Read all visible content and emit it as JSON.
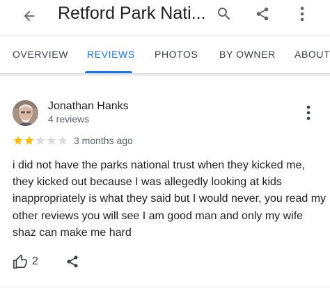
{
  "appbar": {
    "title": "Retford Park Nati...",
    "icons": [
      "back-arrow-icon",
      "search-icon",
      "share-icon",
      "more-vert-icon"
    ]
  },
  "tabs": [
    {
      "label": "OVERVIEW",
      "active": false
    },
    {
      "label": "REVIEWS",
      "active": true
    },
    {
      "label": "PHOTOS",
      "active": false
    },
    {
      "label": "BY OWNER",
      "active": false
    },
    {
      "label": "ABOUT",
      "active": false
    }
  ],
  "review": {
    "author": "Jonathan Hanks",
    "author_reviews": "4 reviews",
    "rating": 2,
    "rating_max": 5,
    "date": "3 months ago",
    "text": "i did not have the parks national trust when they kicked me, they kicked out because I was allegedly looking at kids inappropriately is what they said but I would never, you read my other reviews you will see I am good man and only my wife shaz can make me hard",
    "likes": "2"
  },
  "colors": {
    "accent": "#1a73e8",
    "star_filled": "#fbbc04",
    "star_empty": "#dadce0",
    "text_primary": "#202124",
    "text_secondary": "#5f6368"
  }
}
